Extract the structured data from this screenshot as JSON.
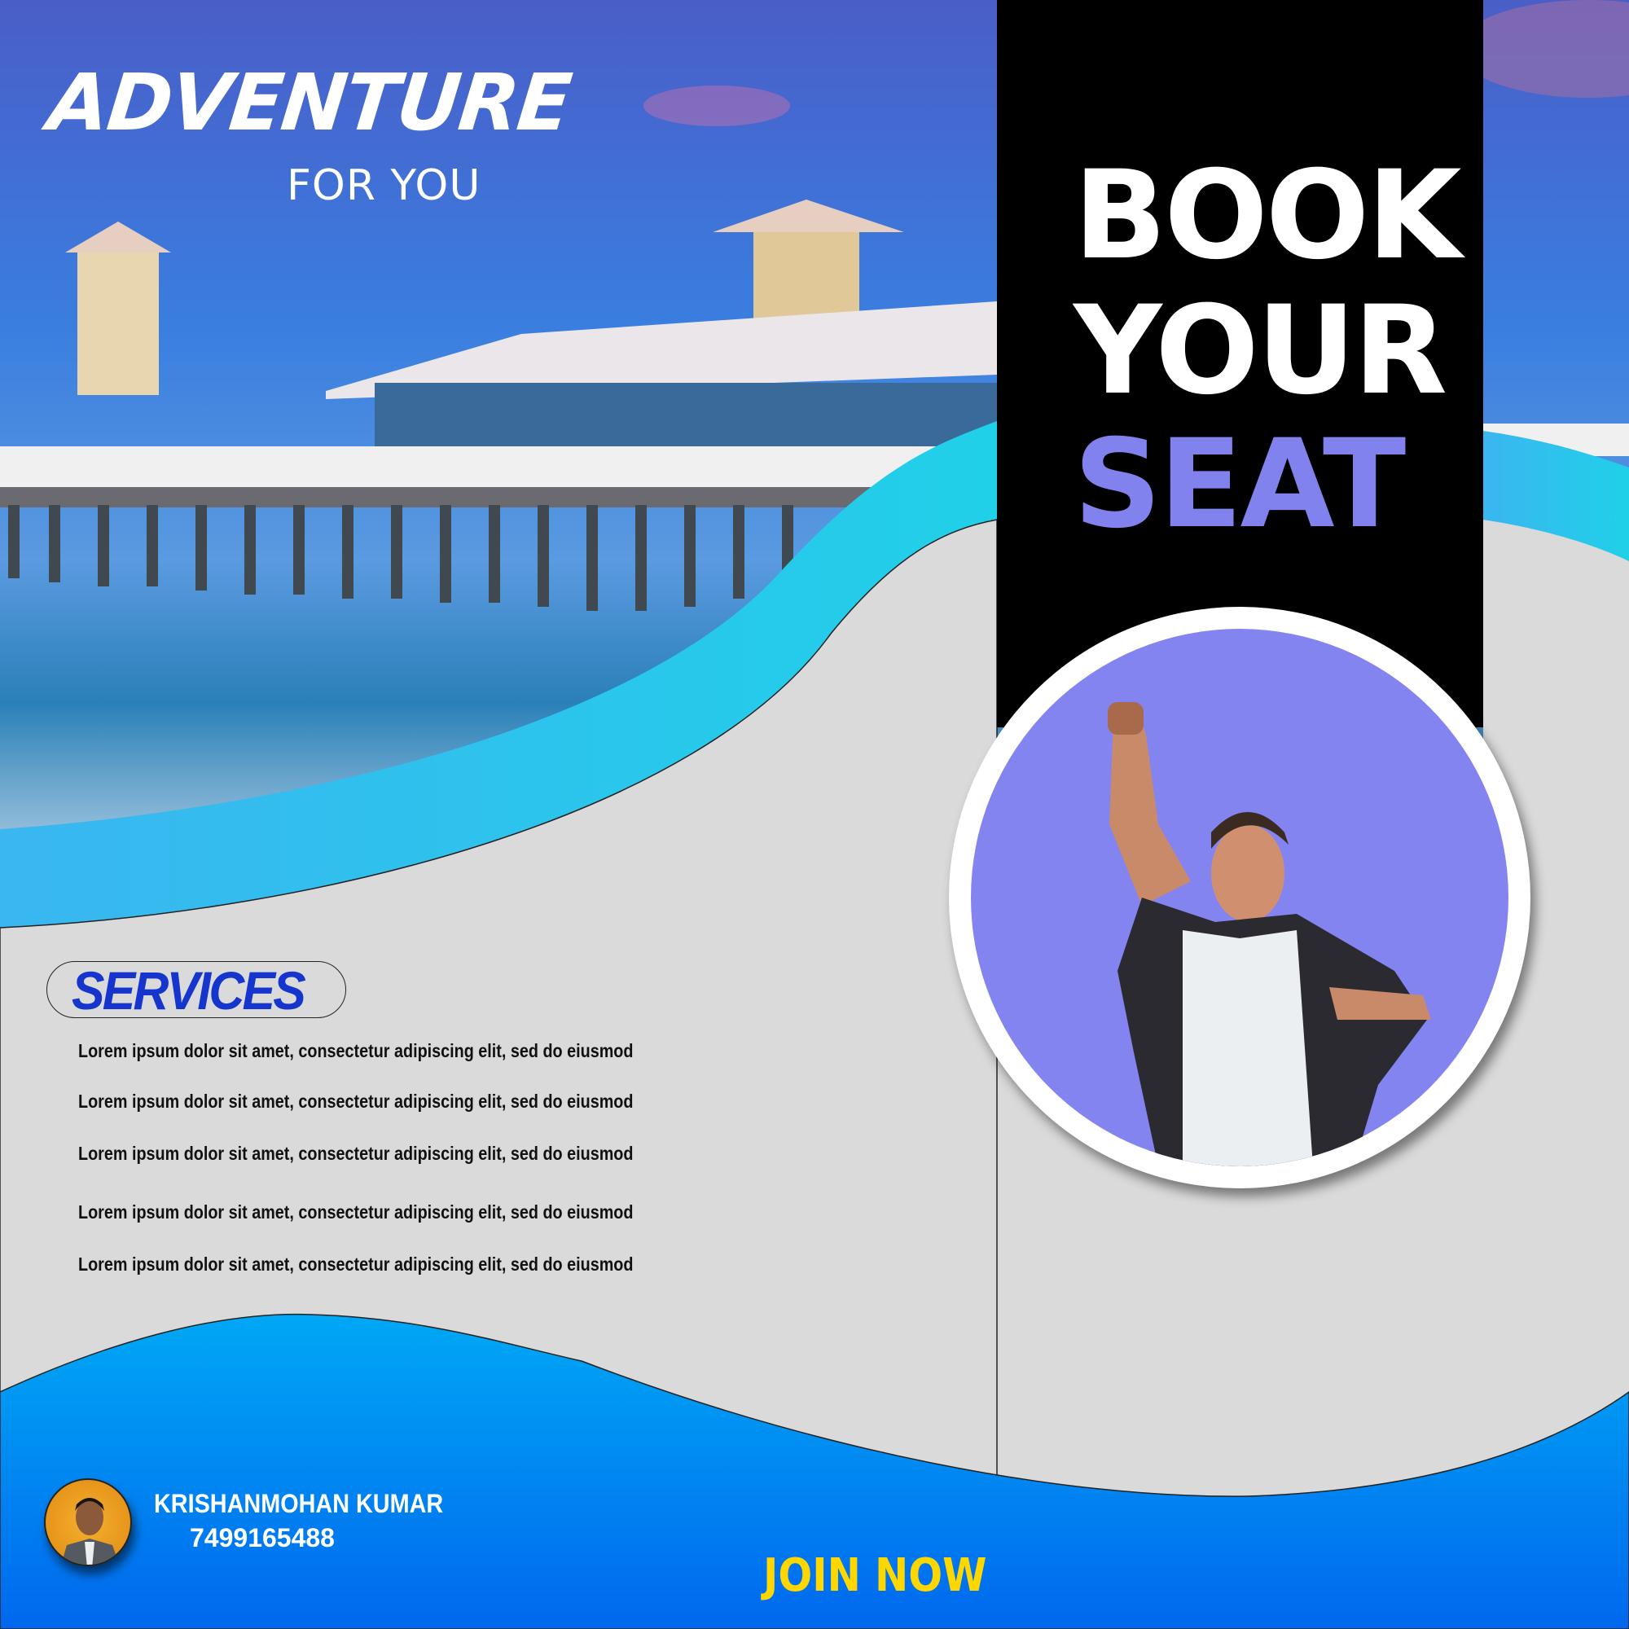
{
  "header": {
    "title": "ADVENTURE",
    "subtitle": "FOR YOU"
  },
  "headline": {
    "line1": "BOOK",
    "line2": "YOUR",
    "line3": "SEAT"
  },
  "services": {
    "title": "SERVICES",
    "items": [
      "Lorem ipsum dolor sit amet, consectetur adipiscing elit, sed do eiusmod",
      "Lorem ipsum dolor sit amet, consectetur adipiscing elit, sed do eiusmod",
      "Lorem ipsum dolor sit amet, consectetur adipiscing elit, sed do eiusmod",
      "Lorem ipsum dolor sit amet, consectetur adipiscing elit, sed do eiusmod",
      "Lorem ipsum dolor sit amet, consectetur adipiscing elit, sed do eiusmod"
    ]
  },
  "contact": {
    "name": "KRISHANMOHAN KUMAR",
    "phone": "7499165488"
  },
  "cta": {
    "label": "JOIN NOW"
  },
  "colors": {
    "accent_purple": "#8282ee",
    "title_blue": "#1535cc",
    "cta_yellow": "#ffd700",
    "wave_cyan": "#30c0f0",
    "wave_blue": "#0078f0"
  },
  "icons": {
    "bullet": "arrowhead-icon"
  }
}
